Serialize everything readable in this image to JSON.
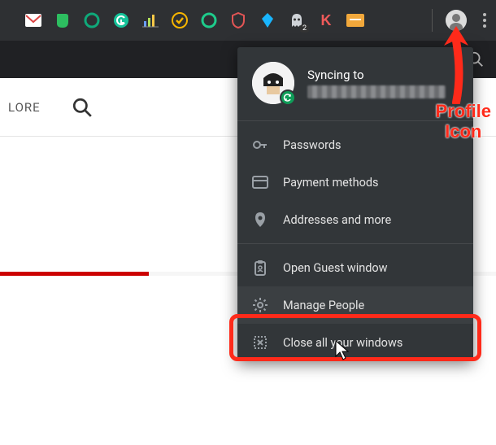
{
  "toolbar": {
    "extensions": [
      {
        "name": "gmail-icon",
        "color": "#ffffff"
      },
      {
        "name": "evernote-icon",
        "color": "#2dbe60"
      },
      {
        "name": "ring-icon-1",
        "color": "#0fa97a"
      },
      {
        "name": "grammarly-icon",
        "color": "#15c39a"
      },
      {
        "name": "graph-icon",
        "color": "#6a9ef8"
      },
      {
        "name": "check-icon",
        "color": "#f7b500"
      },
      {
        "name": "ring-icon-2",
        "color": "#1ecb8b"
      },
      {
        "name": "shield-icon",
        "color": "#e25555"
      },
      {
        "name": "kite-icon",
        "color": "#19b5fe"
      },
      {
        "name": "ghost-icon",
        "color": "#cfd3d8",
        "badge": "2"
      },
      {
        "name": "letter-k-icon",
        "color": "#f05a5a",
        "letter": "K"
      },
      {
        "name": "card-icon",
        "color": "#f2a83b"
      }
    ]
  },
  "page_nav": {
    "explore_label": "LORE"
  },
  "popup": {
    "sync_label": "Syncing to",
    "items_a": [
      {
        "icon": "key-icon",
        "label": "Passwords"
      },
      {
        "icon": "credit-card-icon",
        "label": "Payment methods"
      },
      {
        "icon": "map-pin-icon",
        "label": "Addresses and more"
      }
    ],
    "items_b": [
      {
        "icon": "clipboard-icon",
        "label": "Open Guest window"
      },
      {
        "icon": "gear-icon",
        "label": "Manage People"
      },
      {
        "icon": "close-box-icon",
        "label": "Close all your windows"
      }
    ]
  },
  "annotation": {
    "label_line1": "Profile",
    "label_line2": "Icon"
  }
}
